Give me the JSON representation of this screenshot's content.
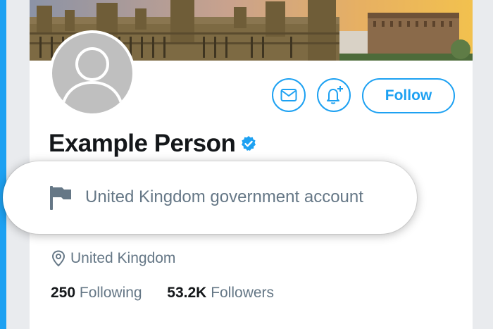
{
  "profile": {
    "name": "Example Person",
    "follow_label": "Follow",
    "label_text": "United Kingdom government account",
    "location": "United Kingdom",
    "following_count": "250",
    "following_label": "Following",
    "followers_count": "53.2K",
    "followers_label": "Followers"
  },
  "icons": {
    "message": "envelope-icon",
    "notify": "bell-plus-icon",
    "verified": "verified-badge-icon",
    "government": "flag-icon",
    "location": "location-pin-icon"
  },
  "colors": {
    "accent": "#1da1f2",
    "text_primary": "#14171a",
    "text_secondary": "#657786"
  }
}
